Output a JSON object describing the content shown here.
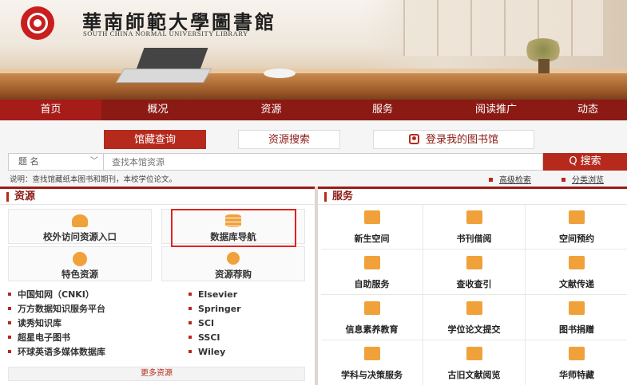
{
  "header": {
    "title_cn": "華南師範大學圖書館",
    "title_en": "SOUTH CHINA NORMAL UNIVERSITY LIBRARY"
  },
  "nav": {
    "items": [
      "首页",
      "概况",
      "资源",
      "服务",
      "阅读推广",
      "动态"
    ]
  },
  "search": {
    "tabs": [
      "馆藏查询",
      "资源搜索",
      "登录我的图书馆"
    ],
    "field_select": "题 名",
    "placeholder": "查找本馆资源",
    "button": "Q 搜索",
    "note": "说明：查找馆藏纸本图书和期刊，本校学位论文。",
    "advanced": "高级检索",
    "classify": "分类浏览"
  },
  "resources": {
    "title": "资源",
    "cards": [
      "校外访问资源入口",
      "数据库导航",
      "特色资源",
      "资源荐购"
    ],
    "list_left": [
      "中国知网（CNKI）",
      "万方数据知识服务平台",
      "读秀知识库",
      "超星电子图书",
      "环球英语多媒体数据库"
    ],
    "list_right": [
      "Elsevier",
      "Springer",
      "SCI",
      "SSCI",
      "Wiley"
    ],
    "more": "更多资源"
  },
  "services": {
    "title": "服务",
    "items": [
      "新生空间",
      "书刊借阅",
      "空间预约",
      "自助服务",
      "查收查引",
      "文献传递",
      "信息素养教育",
      "学位论文提交",
      "图书捐赠",
      "学科与决策服务",
      "古旧文献阅览",
      "华师特藏"
    ]
  },
  "colors": {
    "brand_red": "#8b1a14",
    "accent_red": "#b62a1e",
    "icon_orange": "#f0a13a"
  }
}
